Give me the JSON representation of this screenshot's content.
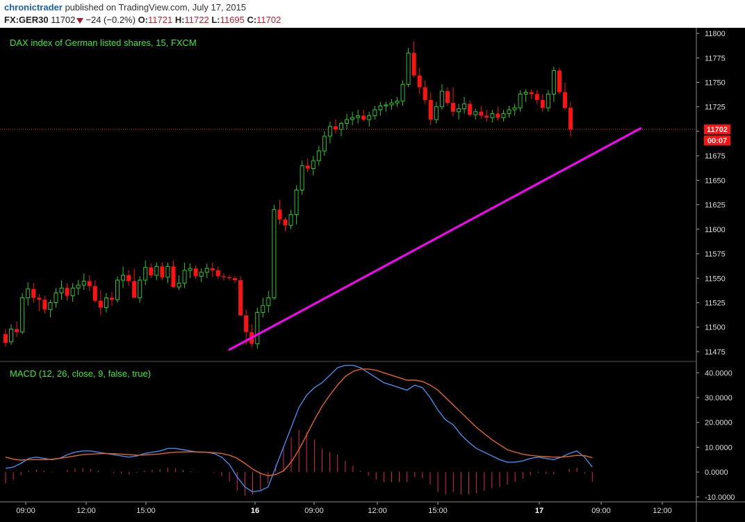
{
  "header": {
    "user": "chronictrader",
    "published_text": "published on TradingView.com, July 17, 2015",
    "symbol": "FX:GER30",
    "last": "11702",
    "change": "−24 (−0.2%)",
    "o_label": "O:",
    "o_val": "11721",
    "h_label": "H:",
    "h_val": "11722",
    "l_label": "L:",
    "l_val": "11695",
    "c_label": "C:",
    "c_val": "11702"
  },
  "chart_data": [
    {
      "type": "candlestick",
      "title": "DAX index of German listed shares, 15, FXCM",
      "ylim": [
        11465,
        11805
      ],
      "y_ticks": [
        11475,
        11500,
        11525,
        11550,
        11575,
        11600,
        11625,
        11650,
        11675,
        11700,
        11725,
        11750,
        11775,
        11800
      ],
      "x_tick_labels": [
        {
          "label": "09:00",
          "bold": false
        },
        {
          "label": "12:00",
          "bold": false
        },
        {
          "label": "15:00",
          "bold": false
        },
        {
          "label": "16",
          "bold": true
        },
        {
          "label": "09:00",
          "bold": false
        },
        {
          "label": "12:00",
          "bold": false
        },
        {
          "label": "15:00",
          "bold": false
        },
        {
          "label": "17",
          "bold": true
        },
        {
          "label": "09:00",
          "bold": false
        },
        {
          "label": "12:00",
          "bold": false
        }
      ],
      "last_price": 11702,
      "last_price_label": "11702",
      "countdown_label": "00:07",
      "trendline": {
        "from": [
          0,
          11477
        ],
        "to": [
          114,
          11703
        ]
      },
      "candles": [
        [
          11493,
          11498,
          11480,
          11484
        ],
        [
          11485,
          11503,
          11482,
          11498
        ],
        [
          11498,
          11506,
          11490,
          11495
        ],
        [
          11495,
          11535,
          11493,
          11530
        ],
        [
          11530,
          11546,
          11522,
          11539
        ],
        [
          11539,
          11545,
          11525,
          11530
        ],
        [
          11530,
          11534,
          11516,
          11528
        ],
        [
          11528,
          11532,
          11514,
          11518
        ],
        [
          11518,
          11528,
          11510,
          11525
        ],
        [
          11525,
          11540,
          11520,
          11535
        ],
        [
          11535,
          11548,
          11528,
          11540
        ],
        [
          11540,
          11545,
          11527,
          11532
        ],
        [
          11532,
          11545,
          11526,
          11540
        ],
        [
          11540,
          11548,
          11533,
          11543
        ],
        [
          11543,
          11555,
          11538,
          11547
        ],
        [
          11547,
          11553,
          11537,
          11542
        ],
        [
          11542,
          11548,
          11525,
          11527
        ],
        [
          11527,
          11538,
          11512,
          11520
        ],
        [
          11520,
          11535,
          11515,
          11530
        ],
        [
          11530,
          11536,
          11522,
          11528
        ],
        [
          11528,
          11552,
          11525,
          11548
        ],
        [
          11548,
          11562,
          11540,
          11553
        ],
        [
          11553,
          11558,
          11542,
          11547
        ],
        [
          11547,
          11560,
          11535,
          11530
        ],
        [
          11530,
          11552,
          11525,
          11548
        ],
        [
          11548,
          11568,
          11543,
          11561
        ],
        [
          11561,
          11565,
          11550,
          11553
        ],
        [
          11553,
          11566,
          11548,
          11562
        ],
        [
          11562,
          11566,
          11548,
          11551
        ],
        [
          11551,
          11566,
          11545,
          11562
        ],
        [
          11562,
          11568,
          11540,
          11541
        ],
        [
          11541,
          11553,
          11538,
          11545
        ],
        [
          11545,
          11566,
          11540,
          11558
        ],
        [
          11558,
          11565,
          11550,
          11560
        ],
        [
          11560,
          11563,
          11549,
          11552
        ],
        [
          11552,
          11560,
          11546,
          11556
        ],
        [
          11556,
          11565,
          11550,
          11560
        ],
        [
          11560,
          11566,
          11551,
          11558
        ],
        [
          11558,
          11562,
          11549,
          11552
        ],
        [
          11552,
          11555,
          11548,
          11551
        ],
        [
          11551,
          11553,
          11548,
          11550
        ],
        [
          11550,
          11552,
          11545,
          11548
        ],
        [
          11548,
          11552,
          11520,
          11512
        ],
        [
          11512,
          11518,
          11482,
          11495
        ],
        [
          11495,
          11503,
          11479,
          11483
        ],
        [
          11483,
          11520,
          11478,
          11515
        ],
        [
          11515,
          11530,
          11510,
          11522
        ],
        [
          11522,
          11537,
          11515,
          11530
        ],
        [
          11530,
          11625,
          11528,
          11620
        ],
        [
          11620,
          11630,
          11605,
          11610
        ],
        [
          11610,
          11612,
          11598,
          11604
        ],
        [
          11604,
          11620,
          11600,
          11615
        ],
        [
          11615,
          11645,
          11605,
          11640
        ],
        [
          11640,
          11670,
          11635,
          11665
        ],
        [
          11665,
          11672,
          11658,
          11662
        ],
        [
          11662,
          11675,
          11655,
          11670
        ],
        [
          11670,
          11685,
          11665,
          11680
        ],
        [
          11680,
          11700,
          11675,
          11695
        ],
        [
          11695,
          11710,
          11688,
          11705
        ],
        [
          11705,
          11712,
          11698,
          11702
        ],
        [
          11702,
          11710,
          11695,
          11708
        ],
        [
          11708,
          11718,
          11702,
          11712
        ],
        [
          11712,
          11720,
          11706,
          11714
        ],
        [
          11714,
          11722,
          11708,
          11716
        ],
        [
          11716,
          11722,
          11710,
          11712
        ],
        [
          11712,
          11720,
          11705,
          11716
        ],
        [
          11716,
          11726,
          11712,
          11722
        ],
        [
          11722,
          11730,
          11716,
          11726
        ],
        [
          11726,
          11730,
          11720,
          11727
        ],
        [
          11727,
          11733,
          11722,
          11729
        ],
        [
          11729,
          11735,
          11725,
          11731
        ],
        [
          11731,
          11752,
          11726,
          11748
        ],
        [
          11748,
          11785,
          11745,
          11780
        ],
        [
          11780,
          11792,
          11755,
          11757
        ],
        [
          11757,
          11765,
          11738,
          11745
        ],
        [
          11745,
          11752,
          11728,
          11732
        ],
        [
          11732,
          11740,
          11706,
          11712
        ],
        [
          11712,
          11730,
          11708,
          11725
        ],
        [
          11725,
          11748,
          11722,
          11741
        ],
        [
          11741,
          11745,
          11726,
          11729
        ],
        [
          11729,
          11745,
          11715,
          11720
        ],
        [
          11720,
          11728,
          11712,
          11723
        ],
        [
          11723,
          11735,
          11718,
          11728
        ],
        [
          11728,
          11732,
          11715,
          11717
        ],
        [
          11717,
          11723,
          11712,
          11720
        ],
        [
          11720,
          11726,
          11713,
          11716
        ],
        [
          11716,
          11722,
          11710,
          11714
        ],
        [
          11714,
          11722,
          11709,
          11718
        ],
        [
          11718,
          11725,
          11711,
          11714
        ],
        [
          11714,
          11722,
          11710,
          11718
        ],
        [
          11718,
          11726,
          11714,
          11722
        ],
        [
          11722,
          11728,
          11716,
          11724
        ],
        [
          11724,
          11742,
          11720,
          11738
        ],
        [
          11738,
          11743,
          11730,
          11740
        ],
        [
          11740,
          11743,
          11733,
          11738
        ],
        [
          11738,
          11742,
          11728,
          11732
        ],
        [
          11732,
          11738,
          11720,
          11724
        ],
        [
          11724,
          11742,
          11720,
          11738
        ],
        [
          11738,
          11766,
          11730,
          11762
        ],
        [
          11762,
          11765,
          11738,
          11740
        ],
        [
          11740,
          11750,
          11722,
          11724
        ],
        [
          11724,
          11730,
          11695,
          11702
        ]
      ]
    },
    {
      "type": "line",
      "title": "MACD (12, 26, close, 9, false, true)",
      "ylim": [
        -12,
        44
      ],
      "y_tick_labels": [
        "-10.0000",
        "0.0000",
        "10.0000",
        "20.0000",
        "30.0000",
        "40.0000"
      ],
      "y_tick_values": [
        -10,
        0,
        10,
        20,
        30,
        40
      ],
      "series": [
        {
          "key": "macd",
          "color": "#3d8ef0",
          "values": [
            1.5,
            2,
            3.5,
            5.5,
            6,
            5.5,
            5,
            5.5,
            7,
            8,
            8.5,
            8.5,
            8,
            7.5,
            7,
            6.5,
            6,
            6.5,
            7.5,
            8,
            8.5,
            9.5,
            9.5,
            9,
            8.5,
            8,
            8,
            7.5,
            6,
            3,
            -2,
            -6,
            -8,
            -7.5,
            -6,
            2,
            10,
            18,
            26,
            31,
            34,
            36,
            39,
            42,
            43,
            43,
            42,
            40,
            38,
            36,
            35,
            34,
            33,
            35,
            34,
            30,
            25,
            21,
            19,
            15,
            12,
            9.5,
            8,
            6.5,
            5,
            4,
            4,
            4.5,
            5.5,
            6,
            5.5,
            5,
            6,
            7.5,
            8.5,
            6,
            2
          ]
        },
        {
          "key": "signal",
          "color": "#e8631c",
          "values": [
            6,
            5.2,
            4.8,
            5,
            5,
            5,
            5.2,
            5.5,
            6,
            6.5,
            7,
            7.2,
            7.4,
            7.5,
            7.4,
            7.2,
            7,
            6.8,
            6.9,
            7.1,
            7.3,
            7.7,
            8,
            8.1,
            8.2,
            8.1,
            8,
            7.8,
            7.5,
            6.8,
            5.5,
            3.5,
            1.2,
            -0.5,
            -1.5,
            -1,
            0.5,
            4,
            9,
            15,
            21,
            26.5,
            31,
            35,
            38.5,
            40.5,
            41.5,
            41.5,
            41,
            40,
            39,
            38,
            37,
            37,
            36.5,
            35,
            33,
            30,
            27,
            24,
            21,
            18,
            15.5,
            13,
            11,
            9,
            8,
            7.2,
            6.7,
            6.4,
            6.2,
            6,
            6,
            6.3,
            6.7,
            6.6,
            5.8
          ]
        },
        {
          "key": "histogram",
          "color": "#e0245e",
          "values": [
            -4.5,
            -3.2,
            -1.3,
            0.5,
            1,
            0.5,
            -0.2,
            0,
            1,
            1.5,
            1.5,
            1.3,
            0.6,
            0,
            -0.4,
            -0.7,
            -1,
            -0.3,
            0.6,
            0.9,
            1.2,
            1.8,
            1.5,
            0.9,
            0.3,
            -0.1,
            0,
            -0.3,
            -1.5,
            -3.8,
            -7.5,
            -9.5,
            -9.2,
            -7,
            -4.5,
            3,
            9.5,
            14,
            17,
            16,
            13,
            9.5,
            8,
            7,
            4.5,
            2.5,
            0.5,
            -1.5,
            -3,
            -4,
            -4,
            -4,
            -4,
            -2,
            -2.5,
            -5,
            -8,
            -9,
            -8,
            -9,
            -9,
            -8.5,
            -7.5,
            -6.5,
            -6,
            -5,
            -4,
            -2.7,
            -1.2,
            -0.4,
            -0.7,
            -1,
            0,
            1.2,
            1.8,
            -0.6,
            -3.8
          ]
        }
      ]
    }
  ],
  "colors": {
    "up_candle": "#22cc22",
    "down_candle": "#ff1111",
    "trendline": "#ff00ff",
    "title_text": "#33ee33",
    "price_tag": "#ff1111",
    "panel_bg": "#000000"
  }
}
